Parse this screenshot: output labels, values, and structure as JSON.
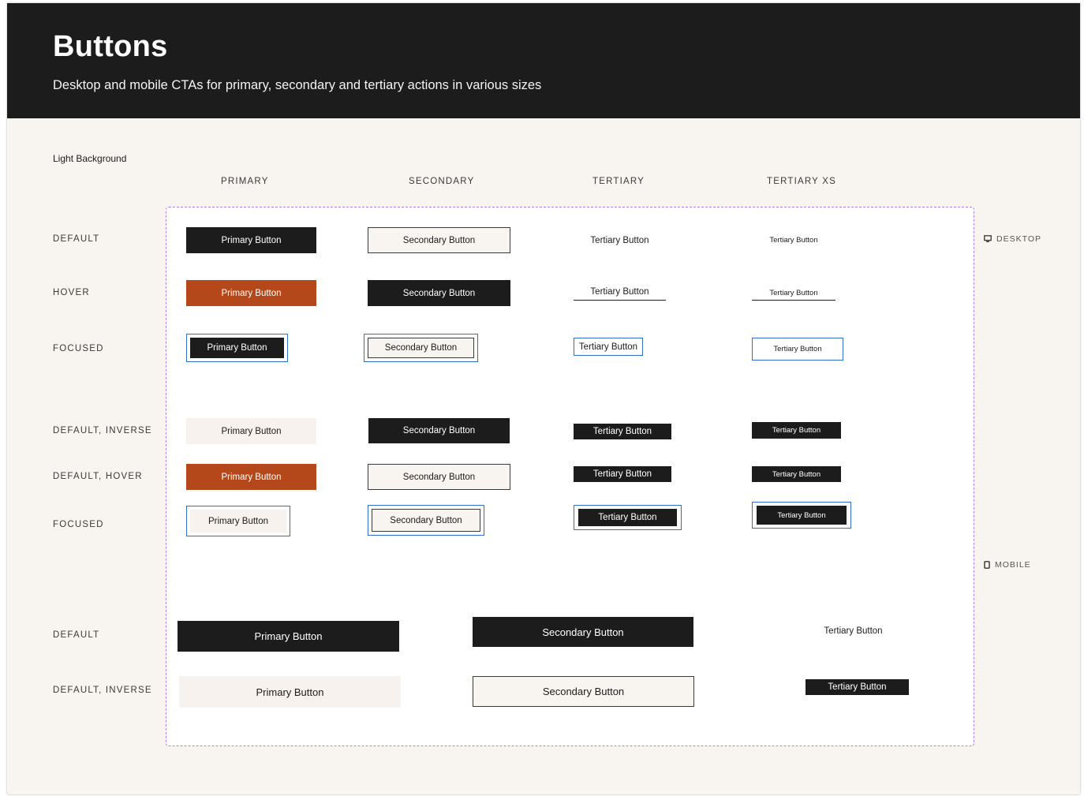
{
  "header": {
    "title": "Buttons",
    "subtitle": "Desktop and mobile CTAs for primary, secondary and tertiary actions in various sizes"
  },
  "section_label": "Light Background",
  "columns": [
    "PRIMARY",
    "SECONDARY",
    "TERTIARY",
    "TERTIARY XS"
  ],
  "rows": {
    "default": "DEFAULT",
    "hover": "HOVER",
    "focused": "FOCUSED",
    "default_inverse": "DEFAULT, INVERSE",
    "default_hover": "DEFAULT, HOVER",
    "focused_inverse": "FOCUSED",
    "mobile_default": "DEFAULT",
    "mobile_default_inverse": "DEFAULT, INVERSE"
  },
  "viewports": {
    "desktop": "DESKTOP",
    "mobile": "MOBILE"
  },
  "labels": {
    "primary": "Primary Button",
    "secondary": "Secondary Button",
    "tertiary": "Tertiary Button"
  },
  "icons": {
    "desktop": "monitor-icon",
    "mobile": "phone-icon"
  },
  "colors": {
    "dark": "#1c1c1c",
    "hover_orange": "#b4481b",
    "focus_blue": "#2d6fcc",
    "frame_dashed": "#b07cf0",
    "background": "#f8f4f0"
  }
}
